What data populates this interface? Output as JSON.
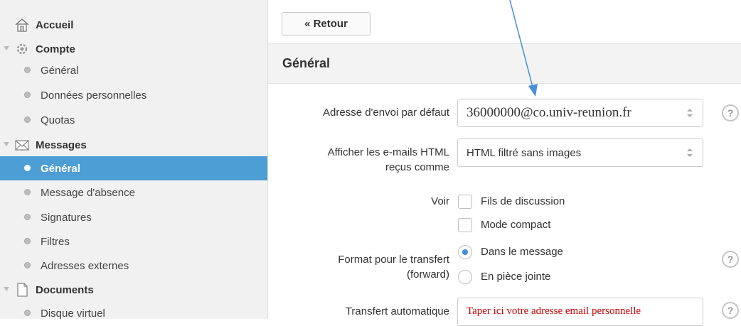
{
  "sidebar": {
    "accueil": "Accueil",
    "compte": {
      "label": "Compte",
      "items": [
        "Général",
        "Données personnelles",
        "Quotas"
      ]
    },
    "messages": {
      "label": "Messages",
      "items": [
        "Général",
        "Message d'absence",
        "Signatures",
        "Filtres",
        "Adresses externes"
      ],
      "active": "Général"
    },
    "documents": {
      "label": "Documents",
      "items": [
        "Disque virtuel"
      ]
    }
  },
  "toolbar": {
    "back_label": "« Retour"
  },
  "section": {
    "title": "Général"
  },
  "form": {
    "sender": {
      "label": "Adresse d'envoi par défaut",
      "value": "36000000@co.univ-reunion.fr"
    },
    "html": {
      "label_line1": "Afficher les e-mails HTML",
      "label_line2": "reçus comme",
      "value": "HTML filtré sans images"
    },
    "voir": {
      "label": "Voir",
      "opt1": "Fils de discussion",
      "opt2": "Mode compact"
    },
    "forward": {
      "label_line1": "Format pour le transfert",
      "label_line2": "(forward)",
      "opt1": "Dans le message",
      "opt2": "En pièce jointe"
    },
    "auto": {
      "label": "Transfert automatique",
      "placeholder": "Taper ici votre adresse email personnelle"
    },
    "help": "?"
  },
  "colors": {
    "active": "#4e9ed6",
    "annotation": "#4a90d9",
    "placeholder": "#cc0000"
  }
}
